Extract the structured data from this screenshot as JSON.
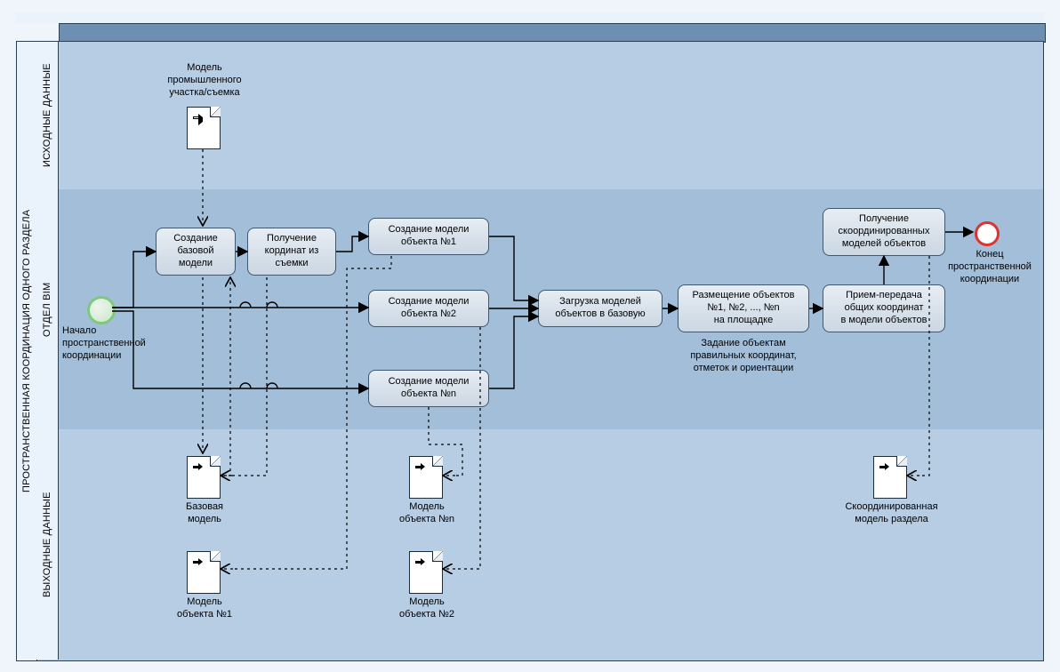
{
  "pool": {
    "title": "ПРОСТРАНСТВЕННАЯ КООРДИНАЦИЯ ОДНОГО РАЗДЕЛА"
  },
  "lanes": {
    "input": "ИСХОДНЫЕ ДАННЫЕ",
    "bim": "ОТДЕЛ BIM",
    "output": "ВЫХОДНЫЕ ДАННЫЕ"
  },
  "events": {
    "start_label": "Начало\nпространственной\nкоординации",
    "end_label": "Конец\nпространственной\nкоординации"
  },
  "tasks": {
    "t1": "Создание\nбазовой\nмодели",
    "t2": "Получение\nкординат из\nсъемки",
    "t3": "Создание модели\nобъекта №1",
    "t4": "Создание модели\nобъекта №2",
    "t5": "Создание модели\nобъекта №n",
    "t6": "Загрузка моделей\nобъектов в базовую",
    "t7": "Размещение объектов\n№1, №2, ..., №n\nна площадке",
    "t7_note": "Задание объектам\nправильных координат,\nотметок и ориентации",
    "t8": "Прием-передача\nобщих координат\nв модели объектов",
    "t9": "Получение\nскоординированных\nмоделей объектов"
  },
  "datadocs": {
    "in1": "Модель\nпромышленного\nучастка/съемка",
    "out1": "Базовая\nмодель",
    "out2": "Модель\nобъекта №1",
    "out3": "Модель\nобъекта №n",
    "out4": "Модель\nобъекта №2",
    "out5": "Скоординированная\nмодель раздела"
  }
}
